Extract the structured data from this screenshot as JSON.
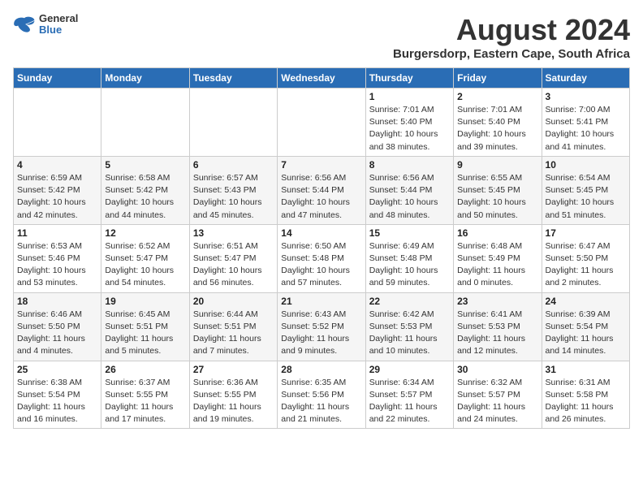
{
  "header": {
    "logo_general": "General",
    "logo_blue": "Blue",
    "month_title": "August 2024",
    "location": "Burgersdorp, Eastern Cape, South Africa"
  },
  "days_of_week": [
    "Sunday",
    "Monday",
    "Tuesday",
    "Wednesday",
    "Thursday",
    "Friday",
    "Saturday"
  ],
  "weeks": [
    [
      {
        "day": "",
        "info": ""
      },
      {
        "day": "",
        "info": ""
      },
      {
        "day": "",
        "info": ""
      },
      {
        "day": "",
        "info": ""
      },
      {
        "day": "1",
        "info": "Sunrise: 7:01 AM\nSunset: 5:40 PM\nDaylight: 10 hours\nand 38 minutes."
      },
      {
        "day": "2",
        "info": "Sunrise: 7:01 AM\nSunset: 5:40 PM\nDaylight: 10 hours\nand 39 minutes."
      },
      {
        "day": "3",
        "info": "Sunrise: 7:00 AM\nSunset: 5:41 PM\nDaylight: 10 hours\nand 41 minutes."
      }
    ],
    [
      {
        "day": "4",
        "info": "Sunrise: 6:59 AM\nSunset: 5:42 PM\nDaylight: 10 hours\nand 42 minutes."
      },
      {
        "day": "5",
        "info": "Sunrise: 6:58 AM\nSunset: 5:42 PM\nDaylight: 10 hours\nand 44 minutes."
      },
      {
        "day": "6",
        "info": "Sunrise: 6:57 AM\nSunset: 5:43 PM\nDaylight: 10 hours\nand 45 minutes."
      },
      {
        "day": "7",
        "info": "Sunrise: 6:56 AM\nSunset: 5:44 PM\nDaylight: 10 hours\nand 47 minutes."
      },
      {
        "day": "8",
        "info": "Sunrise: 6:56 AM\nSunset: 5:44 PM\nDaylight: 10 hours\nand 48 minutes."
      },
      {
        "day": "9",
        "info": "Sunrise: 6:55 AM\nSunset: 5:45 PM\nDaylight: 10 hours\nand 50 minutes."
      },
      {
        "day": "10",
        "info": "Sunrise: 6:54 AM\nSunset: 5:45 PM\nDaylight: 10 hours\nand 51 minutes."
      }
    ],
    [
      {
        "day": "11",
        "info": "Sunrise: 6:53 AM\nSunset: 5:46 PM\nDaylight: 10 hours\nand 53 minutes."
      },
      {
        "day": "12",
        "info": "Sunrise: 6:52 AM\nSunset: 5:47 PM\nDaylight: 10 hours\nand 54 minutes."
      },
      {
        "day": "13",
        "info": "Sunrise: 6:51 AM\nSunset: 5:47 PM\nDaylight: 10 hours\nand 56 minutes."
      },
      {
        "day": "14",
        "info": "Sunrise: 6:50 AM\nSunset: 5:48 PM\nDaylight: 10 hours\nand 57 minutes."
      },
      {
        "day": "15",
        "info": "Sunrise: 6:49 AM\nSunset: 5:48 PM\nDaylight: 10 hours\nand 59 minutes."
      },
      {
        "day": "16",
        "info": "Sunrise: 6:48 AM\nSunset: 5:49 PM\nDaylight: 11 hours\nand 0 minutes."
      },
      {
        "day": "17",
        "info": "Sunrise: 6:47 AM\nSunset: 5:50 PM\nDaylight: 11 hours\nand 2 minutes."
      }
    ],
    [
      {
        "day": "18",
        "info": "Sunrise: 6:46 AM\nSunset: 5:50 PM\nDaylight: 11 hours\nand 4 minutes."
      },
      {
        "day": "19",
        "info": "Sunrise: 6:45 AM\nSunset: 5:51 PM\nDaylight: 11 hours\nand 5 minutes."
      },
      {
        "day": "20",
        "info": "Sunrise: 6:44 AM\nSunset: 5:51 PM\nDaylight: 11 hours\nand 7 minutes."
      },
      {
        "day": "21",
        "info": "Sunrise: 6:43 AM\nSunset: 5:52 PM\nDaylight: 11 hours\nand 9 minutes."
      },
      {
        "day": "22",
        "info": "Sunrise: 6:42 AM\nSunset: 5:53 PM\nDaylight: 11 hours\nand 10 minutes."
      },
      {
        "day": "23",
        "info": "Sunrise: 6:41 AM\nSunset: 5:53 PM\nDaylight: 11 hours\nand 12 minutes."
      },
      {
        "day": "24",
        "info": "Sunrise: 6:39 AM\nSunset: 5:54 PM\nDaylight: 11 hours\nand 14 minutes."
      }
    ],
    [
      {
        "day": "25",
        "info": "Sunrise: 6:38 AM\nSunset: 5:54 PM\nDaylight: 11 hours\nand 16 minutes."
      },
      {
        "day": "26",
        "info": "Sunrise: 6:37 AM\nSunset: 5:55 PM\nDaylight: 11 hours\nand 17 minutes."
      },
      {
        "day": "27",
        "info": "Sunrise: 6:36 AM\nSunset: 5:55 PM\nDaylight: 11 hours\nand 19 minutes."
      },
      {
        "day": "28",
        "info": "Sunrise: 6:35 AM\nSunset: 5:56 PM\nDaylight: 11 hours\nand 21 minutes."
      },
      {
        "day": "29",
        "info": "Sunrise: 6:34 AM\nSunset: 5:57 PM\nDaylight: 11 hours\nand 22 minutes."
      },
      {
        "day": "30",
        "info": "Sunrise: 6:32 AM\nSunset: 5:57 PM\nDaylight: 11 hours\nand 24 minutes."
      },
      {
        "day": "31",
        "info": "Sunrise: 6:31 AM\nSunset: 5:58 PM\nDaylight: 11 hours\nand 26 minutes."
      }
    ]
  ]
}
